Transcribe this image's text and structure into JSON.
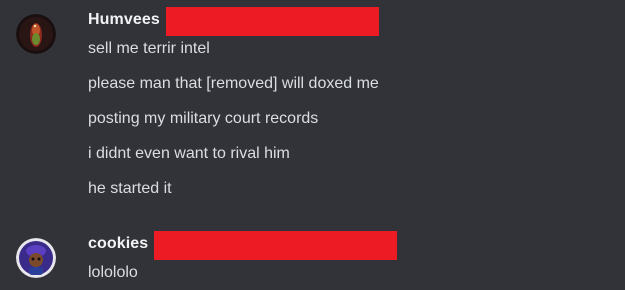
{
  "messages": [
    {
      "username": "Humvees",
      "avatar_icon": "bird-avatar-icon",
      "lines": [
        "sell me terrir intel",
        "please man that [removed] will doxed me",
        "posting my military court records",
        "i didnt even want to rival him",
        "he started it"
      ]
    },
    {
      "username": "cookies",
      "avatar_icon": "character-avatar-icon",
      "lines": [
        "lolololo"
      ]
    }
  ],
  "colors": {
    "background": "#313338",
    "username": "#f2f3f5",
    "message_text": "#dbdee1",
    "redaction": "#ed1c24"
  }
}
